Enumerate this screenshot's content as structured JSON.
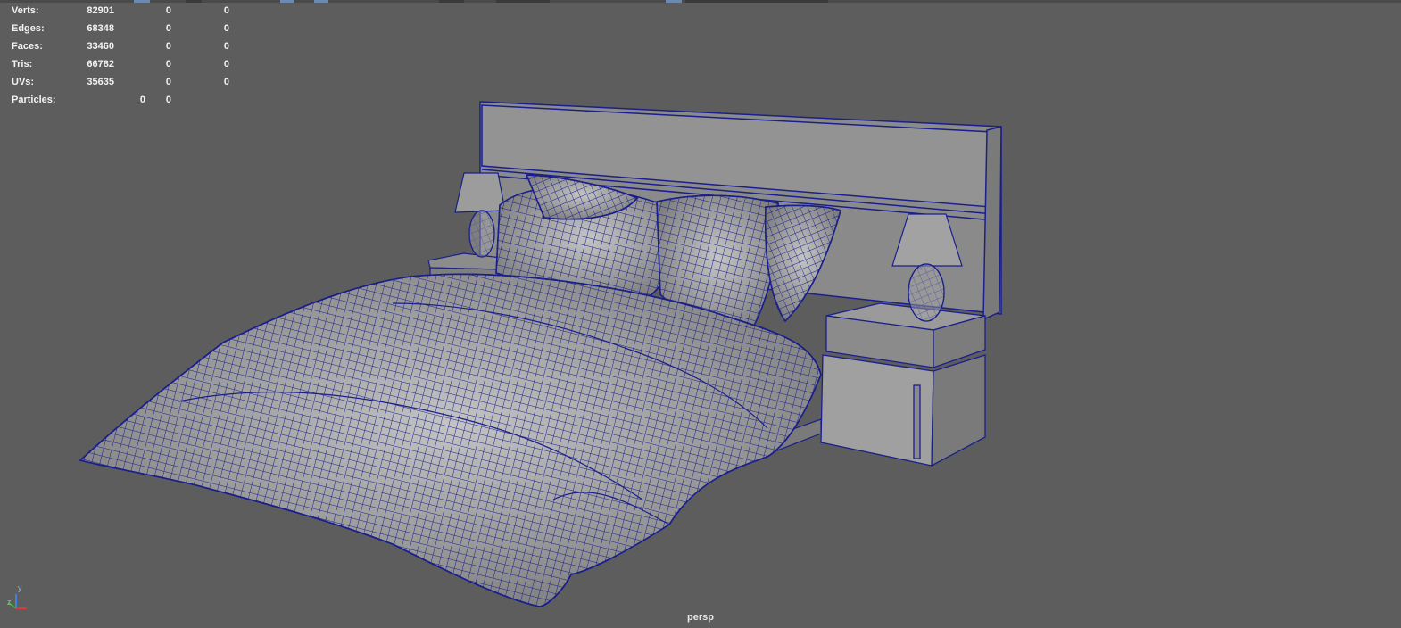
{
  "hud": {
    "rows": [
      {
        "label": "Verts:",
        "c1": "82901",
        "c2": "0",
        "c3": "0"
      },
      {
        "label": "Edges:",
        "c1": "68348",
        "c2": "0",
        "c3": "0"
      },
      {
        "label": "Faces:",
        "c1": "33460",
        "c2": "0",
        "c3": "0"
      },
      {
        "label": "Tris:",
        "c1": "66782",
        "c2": "0",
        "c3": "0"
      },
      {
        "label": "UVs:",
        "c1": "35635",
        "c2": "0",
        "c3": "0"
      },
      {
        "label": "Particles:",
        "c1": "0",
        "c2": "0",
        "c3": ""
      }
    ]
  },
  "viewport": {
    "camera_label": "persp",
    "axis_y": "y",
    "axis_z": "z",
    "wire_color": "#1a1f8c",
    "surface_color": "#9a9a9a"
  }
}
